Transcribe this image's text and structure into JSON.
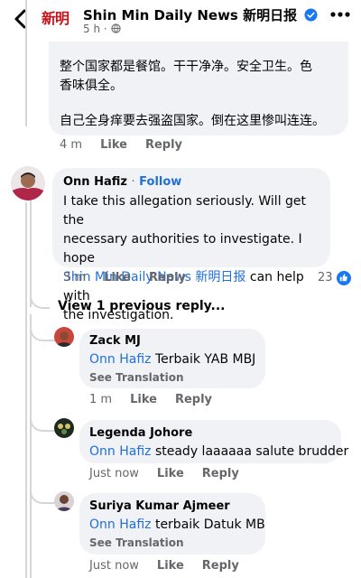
{
  "header": {
    "logo_text": "新明",
    "page_name": "Shin Min Daily News 新明日报",
    "time": "5 h",
    "separator": "·"
  },
  "top_comment": {
    "line1": "整个国家都是餐馆。干干净净。安全卫生。色",
    "line2": "香味俱全。",
    "line3": "自己全身痒要去强盗国家。倒在这里惨叫连连。",
    "time": "4 m",
    "like": "Like",
    "reply": "Reply"
  },
  "main_comment": {
    "name": "Onn Hafiz",
    "dot": "·",
    "follow": "Follow",
    "line1": "I take this allegation seriously. Will get the",
    "line2": "necessary authorities to investigate. I hope",
    "tag": "Shin Min Daily News 新明日报",
    "line3_rest": " can help with",
    "line4": "the investigation.",
    "time": "3 m",
    "like": "Like",
    "reply": "Reply",
    "reaction_count": "23"
  },
  "view_previous": "View 1 previous reply...",
  "replies": [
    {
      "name": "Zack MJ",
      "tag": "Onn Hafiz",
      "text": " Terbaik YAB MBJ",
      "see_translation": "See Translation",
      "time": "1 m",
      "like": "Like",
      "reply": "Reply"
    },
    {
      "name": "Legenda Johore",
      "tag": "Onn Hafiz",
      "text": " steady laaaaaa salute brudder",
      "time": "Just now",
      "like": "Like",
      "reply": "Reply"
    },
    {
      "name": "Suriya Kumar Ajmeer",
      "tag": "Onn Hafiz",
      "text": " terbaik Datuk MB",
      "see_translation": "See Translation",
      "time": "Just now",
      "like": "Like",
      "reply": "Reply"
    }
  ],
  "colors": {
    "link": "#216fdb",
    "bubble": "#f0f2f5",
    "secondary_text": "#65676b",
    "brand_red": "#c8131a",
    "like_blue": "#1877f2"
  },
  "icons": [
    "back-arrow-icon",
    "verified-badge-icon",
    "globe-icon",
    "more-icon",
    "like-reaction-icon"
  ]
}
